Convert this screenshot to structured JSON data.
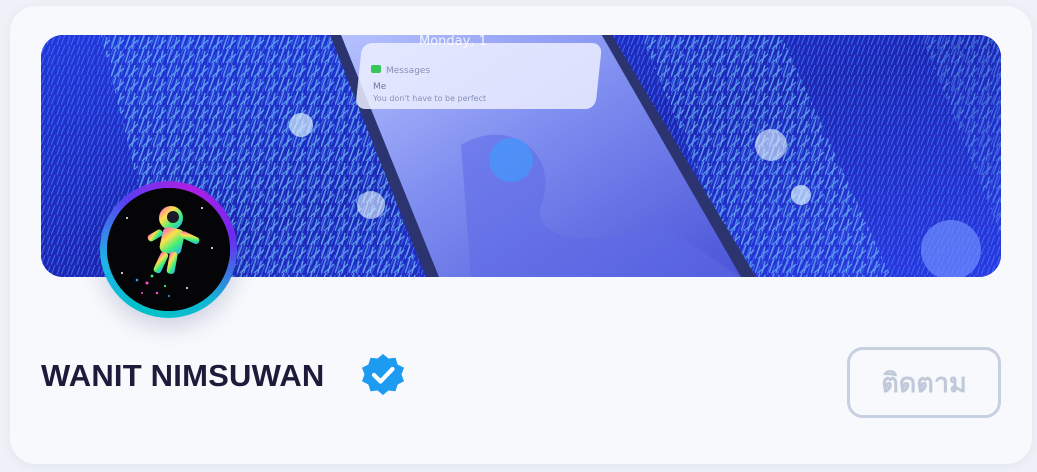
{
  "profile": {
    "name": "WANIT NIMSUWAN",
    "verified": true,
    "verified_badge_icon": "verified-badge-icon",
    "verified_color": "#1d9bf0"
  },
  "cover": {
    "phone_date_text": "Monday, 1",
    "notification_app": "Messages",
    "notification_sender": "Me",
    "notification_text": "You don't have to be perfect"
  },
  "actions": {
    "follow_label": "ติดตาม",
    "follow_border_color": "#c6d0e0"
  },
  "colors": {
    "name_color": "#1d1b3a",
    "card_background": "#f7f9fc",
    "cover_base": "#1f2fbf"
  }
}
